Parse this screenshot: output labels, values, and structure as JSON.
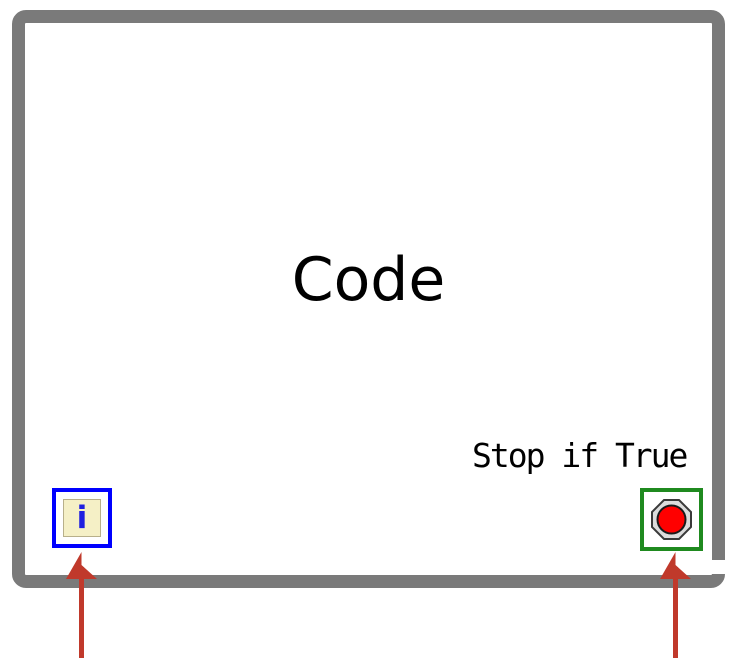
{
  "diagram": {
    "code_label": "Code",
    "stop_label": "Stop if True",
    "iteration_terminal_text": "i"
  },
  "colors": {
    "frame": "#7a7a7a",
    "iteration_border": "#0000ff",
    "iteration_fill": "#f5f0c6",
    "iteration_text": "#1f1fe0",
    "stop_border": "#1f8a1f",
    "stop_dot": "#ff0000",
    "arrow": "#c0392b"
  },
  "icons": {
    "iteration_terminal": "iteration-terminal-icon",
    "conditional_terminal": "stop-sign-icon",
    "arrows": "up-arrow-icon"
  }
}
